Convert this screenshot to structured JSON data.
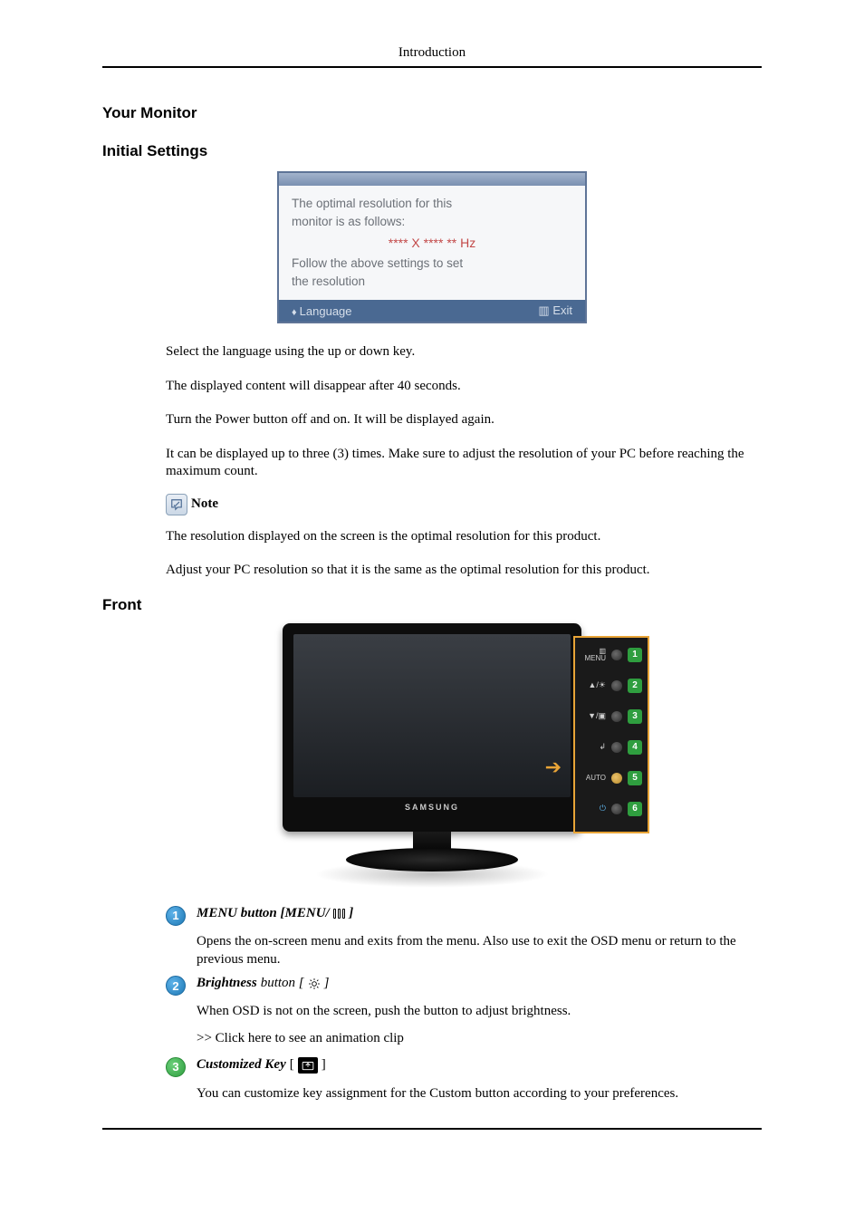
{
  "header": {
    "title": "Introduction"
  },
  "headings": {
    "your_monitor": "Your Monitor",
    "initial_settings": "Initial Settings",
    "front": "Front"
  },
  "osd": {
    "line1": "The optimal resolution for this",
    "line2": "monitor is as follows:",
    "hz": "**** X **** ** Hz",
    "line3": "Follow the above settings to set",
    "line4": "the resolution",
    "footer_left": "Language",
    "footer_right": "▥ Exit"
  },
  "paragraphs": {
    "p1": "Select the language using the up or down key.",
    "p2": "The displayed content will disappear after 40 seconds.",
    "p3": "Turn the Power button off and on. It will be displayed again.",
    "p4": "It can be displayed up to three (3) times. Make sure to adjust the resolution of your PC before reaching the maximum count.",
    "note_label": "Note",
    "p5": "The resolution displayed on the screen is the optimal resolution for this product.",
    "p6": "Adjust your PC resolution so that it is the same as the optimal resolution for this product."
  },
  "monitor": {
    "brand": "SAMSUNG",
    "panel": {
      "menu_top": "▥",
      "menu_label": "MENU",
      "up": "▲/☀",
      "down": "▼/▣",
      "enter": "↲",
      "auto": "AUTO",
      "power": "⏻"
    }
  },
  "items": {
    "i1": {
      "num": "1",
      "title_prefix": "MENU button [MENU/",
      "title_suffix": "]",
      "desc": "Opens the on-screen menu and exits from the menu. Also use to exit the OSD menu or return to the previous menu."
    },
    "i2": {
      "num": "2",
      "title_strong": "Brightness",
      "title_light": " button [",
      "title_suffix": "]",
      "desc1": "When OSD is not on the screen, push the button to adjust brightness.",
      "desc2": ">> Click here to see an animation clip"
    },
    "i3": {
      "num": "3",
      "title": "Customized Key",
      "bracket_open": "[",
      "bracket_close": "]",
      "desc": "You can customize key assignment for the Custom button according to your preferences."
    }
  }
}
